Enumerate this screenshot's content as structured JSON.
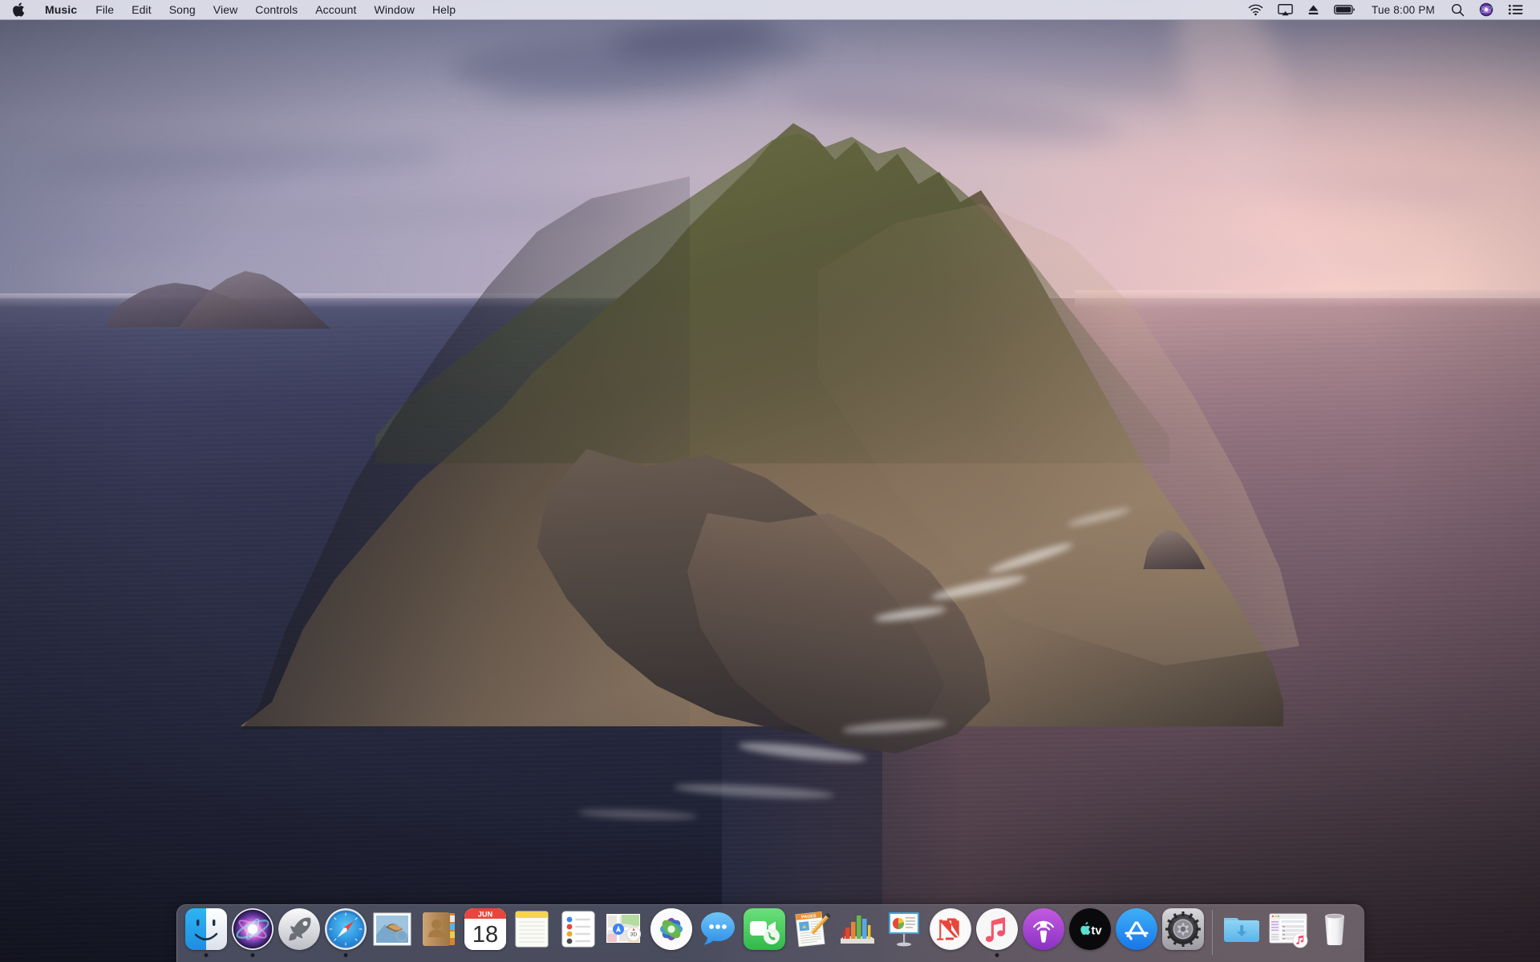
{
  "os": {
    "name": "macOS Catalina",
    "wallpaper_name": "Catalina (Day)"
  },
  "menubar": {
    "apple_icon": "apple-logo-icon",
    "items": [
      {
        "label": "Music",
        "bold": true
      },
      {
        "label": "File",
        "bold": false
      },
      {
        "label": "Edit",
        "bold": false
      },
      {
        "label": "Song",
        "bold": false
      },
      {
        "label": "View",
        "bold": false
      },
      {
        "label": "Controls",
        "bold": false
      },
      {
        "label": "Account",
        "bold": false
      },
      {
        "label": "Window",
        "bold": false
      },
      {
        "label": "Help",
        "bold": false
      }
    ],
    "status": {
      "wifi": "wifi-icon",
      "airplay": "airplay-display-icon",
      "eject": "eject-icon",
      "battery": "battery-icon",
      "clock": "Tue 8:00 PM",
      "spotlight": "search-icon",
      "siri": "siri-icon",
      "control_center": "control-center-icon"
    },
    "colors": {
      "background": "#dfe0eb",
      "text": "#1b1c26"
    }
  },
  "dock": {
    "apps": [
      {
        "name": "Finder",
        "icon": "finder-icon",
        "running": true
      },
      {
        "name": "Siri",
        "icon": "siri-icon",
        "running": true
      },
      {
        "name": "Launchpad",
        "icon": "launchpad-icon",
        "running": false
      },
      {
        "name": "Safari",
        "icon": "safari-icon",
        "running": true
      },
      {
        "name": "Mail",
        "icon": "mail-icon",
        "running": false
      },
      {
        "name": "Contacts",
        "icon": "contacts-icon",
        "running": false
      },
      {
        "name": "Calendar",
        "icon": "calendar-icon",
        "running": false,
        "month": "JUN",
        "day": "18"
      },
      {
        "name": "Notes",
        "icon": "notes-icon",
        "running": false
      },
      {
        "name": "Reminders",
        "icon": "reminders-icon",
        "running": false
      },
      {
        "name": "Maps",
        "icon": "maps-icon",
        "running": false,
        "badge": "3D"
      },
      {
        "name": "Photos",
        "icon": "photos-icon",
        "running": false
      },
      {
        "name": "Messages",
        "icon": "messages-icon",
        "running": false
      },
      {
        "name": "FaceTime",
        "icon": "facetime-icon",
        "running": false
      },
      {
        "name": "Pages",
        "icon": "pages-icon",
        "running": false,
        "label": "PAGES"
      },
      {
        "name": "Numbers",
        "icon": "numbers-icon",
        "running": false
      },
      {
        "name": "Keynote",
        "icon": "keynote-icon",
        "running": false
      },
      {
        "name": "News",
        "icon": "news-icon",
        "running": false
      },
      {
        "name": "Music",
        "icon": "music-icon",
        "running": true
      },
      {
        "name": "Podcasts",
        "icon": "podcasts-icon",
        "running": false
      },
      {
        "name": "Apple TV",
        "icon": "apple-tv-icon",
        "running": false,
        "label": "tv"
      },
      {
        "name": "App Store",
        "icon": "app-store-icon",
        "running": false
      },
      {
        "name": "System Preferences",
        "icon": "system-preferences-icon",
        "running": false
      }
    ],
    "others": [
      {
        "name": "Downloads",
        "icon": "downloads-folder-icon"
      },
      {
        "name": "Music Window",
        "icon": "minimized-music-window-icon"
      },
      {
        "name": "Trash",
        "icon": "trash-icon"
      }
    ],
    "colors": {
      "background_left": "#565a6c",
      "background_right": "#7a6e76",
      "indicator": "#141418"
    }
  },
  "wallpaper": {
    "colors": {
      "sky_left": "#8d8fae",
      "sky_right": "#f0d2d0",
      "ocean_left": "#2a2c44",
      "ocean_right": "#7d626f",
      "rock": "#7a6752",
      "vegetation": "#6b6b3e"
    }
  }
}
